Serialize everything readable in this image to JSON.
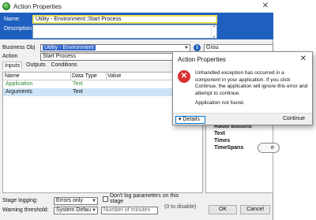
{
  "window": {
    "title": "Action Properties",
    "close": "✕"
  },
  "header": {
    "name_label": "Name:",
    "name_value": "Utility - Environment::Start Process",
    "description_label": "Description:"
  },
  "form": {
    "business_object_label": "Business Obj",
    "business_object_value": "Utility - Environment",
    "action_label": "Action",
    "action_value": "Start Process",
    "info_glyph": "i",
    "group_label": "Grou"
  },
  "tabs": [
    "Inputs",
    "Outputs",
    "Conditions"
  ],
  "grid": {
    "columns": [
      "Name",
      "Data Type",
      "Value"
    ],
    "rows": [
      {
        "name": "Application",
        "type": "Text"
      },
      {
        "name": "Arguments",
        "type": "Text"
      }
    ]
  },
  "right_panel": {
    "items": [
      "Radio Buttons",
      "Text",
      "Times",
      "TimeSpans"
    ],
    "oval_button_label": "e"
  },
  "bottom": {
    "stage_logging_label": "Stage logging:",
    "stage_logging_value": "Errors only",
    "dont_log_label": "Don't log parameters on this stage",
    "warning_label": "Warning threshold:",
    "warning_value": "System Defau",
    "minutes_placeholder": "Number of minutes",
    "to_disable": "(0 to disable)",
    "ok": "OK",
    "cancel": "Cancel"
  },
  "dialog": {
    "title": "Action Properties",
    "close": "✕",
    "message": "Unhandled exception has occurred in a component in your application. If you click Continue, the application will ignore this error and attempt to continue.",
    "detail": "Application not found.",
    "details_button": "Details",
    "continue_button": "Continue"
  },
  "colors": {
    "header_blue": "#1f5fbf",
    "name_highlight": "#e9e05a",
    "error_red": "#d93030",
    "row_selected": "#cde3f6"
  },
  "icons": [
    "app-icon",
    "info-icon",
    "error-icon",
    "chevron-down-icon",
    "close-icon"
  ]
}
